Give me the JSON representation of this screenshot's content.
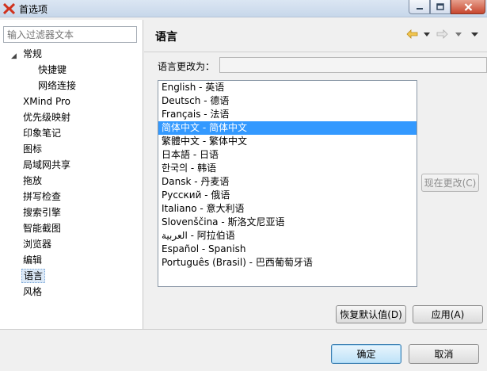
{
  "window": {
    "title": "首选项",
    "brand_color": "#d0321e"
  },
  "filter": {
    "placeholder": "输入过滤器文本"
  },
  "tree": {
    "items": [
      {
        "label": "常规",
        "expanded": true
      },
      {
        "label": "快捷键",
        "child": true
      },
      {
        "label": "网络连接",
        "child": true
      },
      {
        "label": "XMind Pro"
      },
      {
        "label": "优先级映射"
      },
      {
        "label": "印象笔记"
      },
      {
        "label": "图标"
      },
      {
        "label": "局域网共享"
      },
      {
        "label": "拖放"
      },
      {
        "label": "拼写检查"
      },
      {
        "label": "搜索引擎"
      },
      {
        "label": "智能截图"
      },
      {
        "label": "浏览器"
      },
      {
        "label": "编辑"
      },
      {
        "label": "语言",
        "selected": true
      },
      {
        "label": "风格"
      }
    ]
  },
  "page": {
    "title": "语言",
    "change_label": "语言更改为：",
    "change_value": "",
    "languages": [
      "English - 英语",
      "Deutsch - 德语",
      "Français - 法语",
      "简体中文 - 简体中文",
      "繁體中文 - 繁体中文",
      "日本語 - 日语",
      "한국의 - 韩语",
      "Dansk - 丹麦语",
      "Русский - 俄语",
      "Italiano - 意大利语",
      "Slovenščina - 斯洛文尼亚语",
      "العربية - 阿拉伯语",
      "Español - Spanish",
      "Português (Brasil) - 巴西葡萄牙语"
    ],
    "selected_index": 3,
    "change_now": "现在更改(C)",
    "restore_defaults": "恢复默认值(D)",
    "apply": "应用(A)",
    "selection_color": "#3399ff"
  },
  "dialog": {
    "ok": "确定",
    "cancel": "取消"
  }
}
